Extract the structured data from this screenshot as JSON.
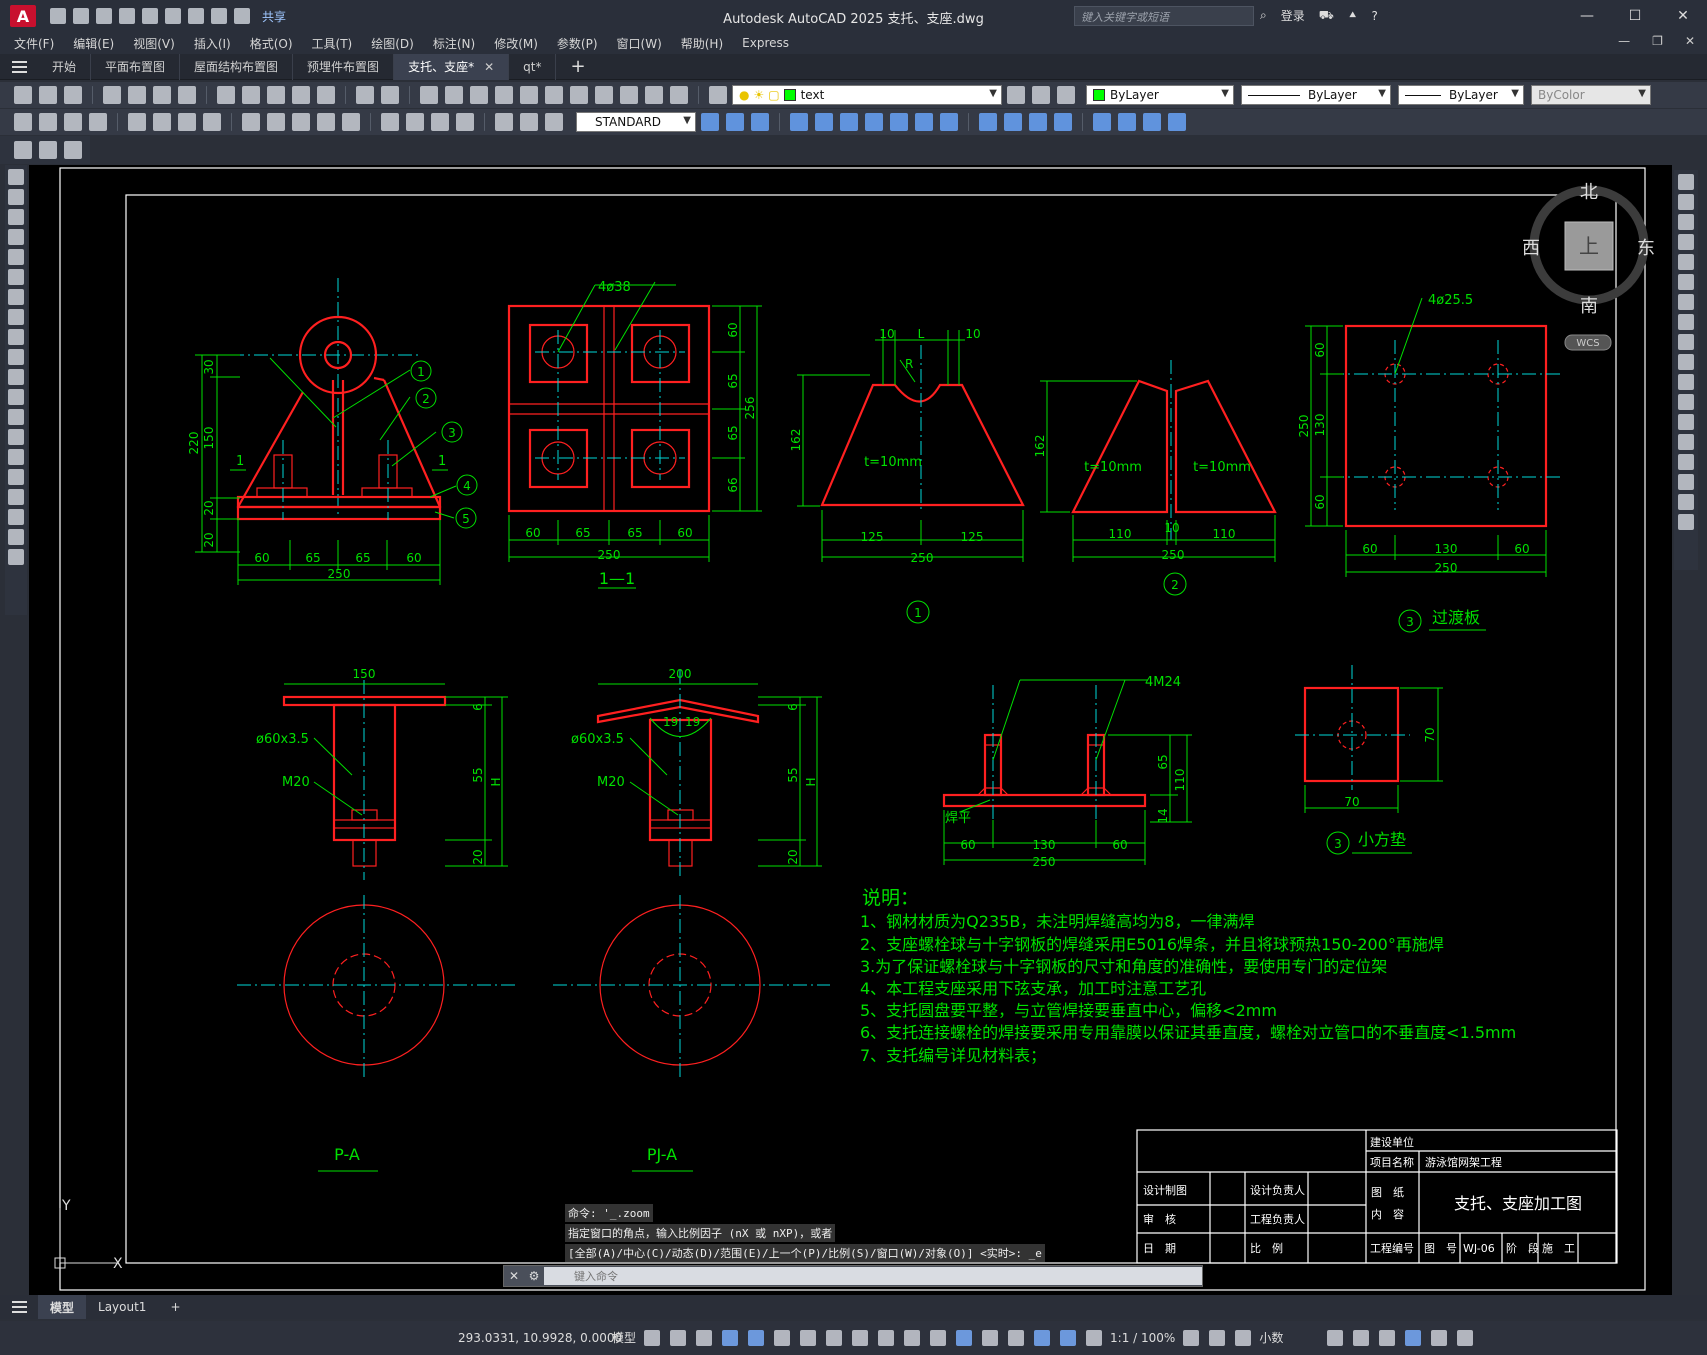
{
  "app": {
    "title": "Autodesk AutoCAD 2025    支托、支座.dwg",
    "logo": "A",
    "share": "共享",
    "search_placeholder": "键入关键字或短语",
    "login": "登录"
  },
  "menus": [
    "文件(F)",
    "编辑(E)",
    "视图(V)",
    "插入(I)",
    "格式(O)",
    "工具(T)",
    "绘图(D)",
    "标注(N)",
    "修改(M)",
    "参数(P)",
    "窗口(W)",
    "帮助(H)",
    "Express"
  ],
  "tabs": [
    {
      "label": "开始",
      "active": false
    },
    {
      "label": "平面布置图",
      "active": false
    },
    {
      "label": "屋面结构布置图",
      "active": false
    },
    {
      "label": "预埋件布置图",
      "active": false
    },
    {
      "label": "支托、支座*",
      "active": true
    },
    {
      "label": "qt*",
      "active": false
    }
  ],
  "toolbar": {
    "layer_name": "text",
    "color": "ByLayer",
    "linetype": "ByLayer",
    "lineweight": "ByLayer",
    "plotstyle": "ByColor",
    "text_style": "STANDARD"
  },
  "viewcube": {
    "north": "北",
    "south": "南",
    "east": "东",
    "west": "西",
    "face": "上",
    "wcs": "WCS"
  },
  "drawing": {
    "view1": {
      "dims_bottom": [
        "60",
        "65",
        "65",
        "60"
      ],
      "dim_total": "250",
      "dims_left": [
        "30",
        "150",
        "20",
        "20"
      ],
      "dim_left_total": "220",
      "section_mark": "1",
      "callouts": [
        "1",
        "2",
        "3",
        "4",
        "5"
      ]
    },
    "view2": {
      "label": "4ø38",
      "dims_bottom": [
        "60",
        "65",
        "65",
        "60"
      ],
      "dim_total": "250",
      "dims_right": [
        "60",
        "65",
        "65",
        "66"
      ],
      "dim_right_total": "256",
      "title": "1—1"
    },
    "view3": {
      "dims_top": [
        "10",
        "L",
        "10"
      ],
      "radius": "R",
      "dim_left": "162",
      "thickness": "t=10mm",
      "dims_bottom": [
        "125",
        "125"
      ],
      "dim_total": "250",
      "number": "1"
    },
    "view4": {
      "dim_left": "162",
      "thickness_left": "t=10mm",
      "thickness_right": "t=10mm",
      "dims_bottom": [
        "110",
        "10",
        "110"
      ],
      "dim_total": "250",
      "number": "2"
    },
    "view5": {
      "label": "4ø25.5",
      "dims_left": [
        "60",
        "130",
        "60"
      ],
      "dim_left_total": "250",
      "dims_bottom": [
        "60",
        "130",
        "60"
      ],
      "dim_total": "250",
      "number": "3",
      "title": "过渡板"
    },
    "view6": {
      "dim_top": "150",
      "tube": "ø60x3.5",
      "bolt": "M20",
      "dims_right": [
        "6",
        "55",
        "20"
      ],
      "dim_h": "H",
      "title": "P-A"
    },
    "view7": {
      "dim_top": "200",
      "tube": "ø60x3.5",
      "bolt": "M20",
      "angles": [
        "19",
        "19"
      ],
      "dims_right": [
        "6",
        "55",
        "20"
      ],
      "dim_h": "H",
      "title": "PJ-A"
    },
    "view8": {
      "label": "4M24",
      "weld": "焊平",
      "dims_right": [
        "65",
        "110",
        "14"
      ],
      "dims_bottom": [
        "60",
        "130",
        "60"
      ],
      "dim_total": "250"
    },
    "view9": {
      "dim_right": "70",
      "dim_bottom": "70",
      "number": "3",
      "title": "小方垫"
    },
    "notes": {
      "heading": "说明：",
      "lines": [
        "1、钢材材质为Q235B，未注明焊缝高均为8，一律满焊",
        "2、支座螺栓球与十字钢板的焊缝采用E5016焊条，并且将球预热150-200°再施焊",
        "3.为了保证螺栓球与十字钢板的尺寸和角度的准确性，要使用专门的定位架",
        "4、本工程支座采用下弦支承，加工时注意工艺孔",
        "5、支托圆盘要平整，与立管焊接要垂直中心，偏移<2mm",
        "6、支托连接螺栓的焊接要采用专用靠膜以保证其垂直度，螺栓对立管口的不垂直度<1.5mm",
        "7、支托编号详见材料表；"
      ]
    },
    "titleblock": {
      "owner_label": "建设单位",
      "owner_value": "",
      "project_label": "项目名称",
      "project_value": "游泳馆网架工程",
      "drawn_label": "设计制图",
      "designer_label": "设计负责人",
      "review_label": "审　核",
      "engineer_label": "工程负责人",
      "date_label": "日　期",
      "scale_label": "比　例",
      "content_label_1": "图　纸",
      "content_label_2": "内　容",
      "content_value": "支托、支座加工图",
      "project_no_label": "工程编号",
      "sheet_label": "图　号",
      "sheet_value": "WJ-06",
      "stage_label": "阶　段",
      "stage_value": "施　工"
    }
  },
  "ucs": {
    "y": "Y",
    "x": "X"
  },
  "command": {
    "history": [
      "命令: '_.zoom",
      "指定窗口的角点，输入比例因子 (nX 或 nXP)，或者",
      "[全部(A)/中心(C)/动态(D)/范围(E)/上一个(P)/比例(S)/窗口(W)/对象(O)] <实时>: _e"
    ],
    "placeholder": "键入命令"
  },
  "layout_tabs": [
    {
      "label": "模型",
      "active": true
    },
    {
      "label": "Layout1",
      "active": false
    }
  ],
  "status": {
    "coords": "293.0331, 10.9928, 0.0000",
    "model": "模型",
    "scale": "1:1 / 100%",
    "units": "小数"
  },
  "colors": {
    "cad_red": "#ff0000",
    "cad_green": "#00ff00",
    "cad_cyan": "#00ffff",
    "cad_yellow": "#ffff00",
    "canvas_bg": "#000000"
  }
}
